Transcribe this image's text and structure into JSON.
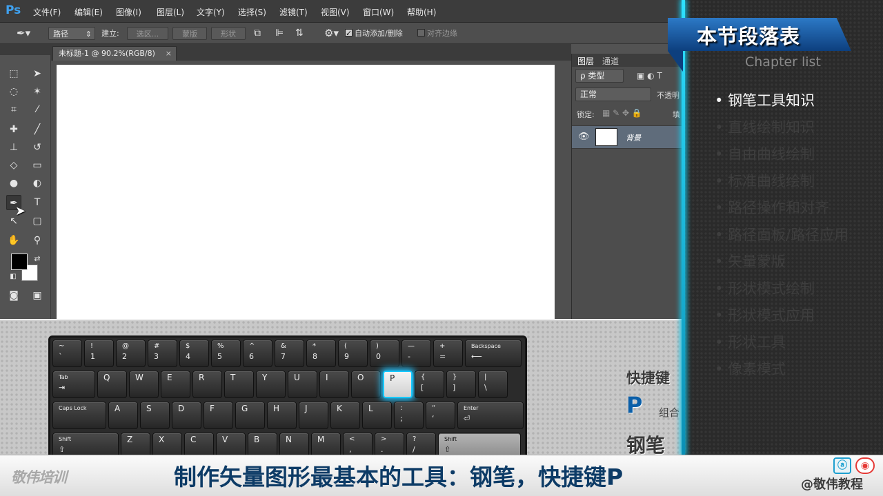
{
  "app": {
    "name": "Ps"
  },
  "menu": [
    "文件(F)",
    "编辑(E)",
    "图像(I)",
    "图层(L)",
    "文字(Y)",
    "选择(S)",
    "滤镜(T)",
    "视图(V)",
    "窗口(W)",
    "帮助(H)"
  ],
  "options": {
    "mode_value": "路径",
    "build_label": "建立:",
    "btn_selection": "选区...",
    "btn_mask": "蒙版",
    "btn_shape": "形状",
    "auto_add_delete": "自动添加/删除",
    "align_edges": "对齐边缘"
  },
  "document": {
    "tab_title": "未标题-1 @ 90.2%(RGB/8)",
    "tab_close": "×"
  },
  "layers_panel": {
    "tab_layers": "图层",
    "tab_channels": "通道",
    "filter_kind": "ρ 类型",
    "blend_mode": "正常",
    "opacity_label": "不透明",
    "lock_label": "锁定:",
    "fill_label": "填",
    "layer_name": "背景"
  },
  "keyboard": {
    "highlight_key": "P",
    "rows": [
      [
        [
          "~",
          "`"
        ],
        [
          "!",
          "1"
        ],
        [
          "@",
          "2"
        ],
        [
          "#",
          "3"
        ],
        [
          "$",
          "4"
        ],
        [
          "%",
          "5"
        ],
        [
          "^",
          "6"
        ],
        [
          "&",
          "7"
        ],
        [
          "*",
          "8"
        ],
        [
          "(",
          "9"
        ],
        [
          ")",
          "0"
        ],
        [
          "—",
          "-"
        ],
        [
          "+",
          "="
        ],
        [
          "Backspace",
          "⟵"
        ]
      ],
      [
        [
          "Tab",
          "⇥"
        ],
        [
          "Q",
          ""
        ],
        [
          "W",
          ""
        ],
        [
          "E",
          ""
        ],
        [
          "R",
          ""
        ],
        [
          "T",
          ""
        ],
        [
          "Y",
          ""
        ],
        [
          "U",
          ""
        ],
        [
          "I",
          ""
        ],
        [
          "O",
          ""
        ],
        [
          "P",
          ""
        ],
        [
          "{",
          "["
        ],
        [
          "}",
          "]"
        ],
        [
          "|",
          "\\"
        ]
      ],
      [
        [
          "Caps Lock",
          ""
        ],
        [
          "A",
          ""
        ],
        [
          "S",
          ""
        ],
        [
          "D",
          ""
        ],
        [
          "F",
          ""
        ],
        [
          "G",
          ""
        ],
        [
          "H",
          ""
        ],
        [
          "J",
          ""
        ],
        [
          "K",
          ""
        ],
        [
          "L",
          ""
        ],
        [
          ":",
          ";"
        ],
        [
          "“",
          "‘"
        ],
        [
          "Enter",
          "⏎"
        ]
      ],
      [
        [
          "Shift",
          "⇧"
        ],
        [
          "Z",
          ""
        ],
        [
          "X",
          ""
        ],
        [
          "C",
          ""
        ],
        [
          "V",
          ""
        ],
        [
          "B",
          ""
        ],
        [
          "N",
          ""
        ],
        [
          "M",
          ""
        ],
        [
          "<",
          ","
        ],
        [
          ">",
          "."
        ],
        [
          "?",
          "/"
        ],
        [
          "Shift",
          "⇧"
        ]
      ]
    ]
  },
  "shortcut": {
    "label": "快捷键",
    "key": "P",
    "combo": "组合",
    "tool": "钢笔"
  },
  "chapter": {
    "title": "本节段落表",
    "subtitle": "Chapter list",
    "items": [
      "钢笔工具知识",
      "直线绘制知识",
      "自由曲线绘制",
      "标准曲线绘制",
      "路径操作和对齐",
      "路径面板/路径应用",
      "矢量蒙版",
      "形状模式绘制",
      "形状模式应用",
      "形状工具",
      "像素模式"
    ],
    "current_index": 0
  },
  "caption": {
    "text": "制作矢量图形最基本的工具：钢笔，快捷键P",
    "brand_left": "敬伟培训",
    "brand_right": "@敬伟教程"
  },
  "colors": {
    "accent_blue": "#0d3b66",
    "glow": "#17c4e6",
    "ps_blue": "#3fa1ef"
  }
}
